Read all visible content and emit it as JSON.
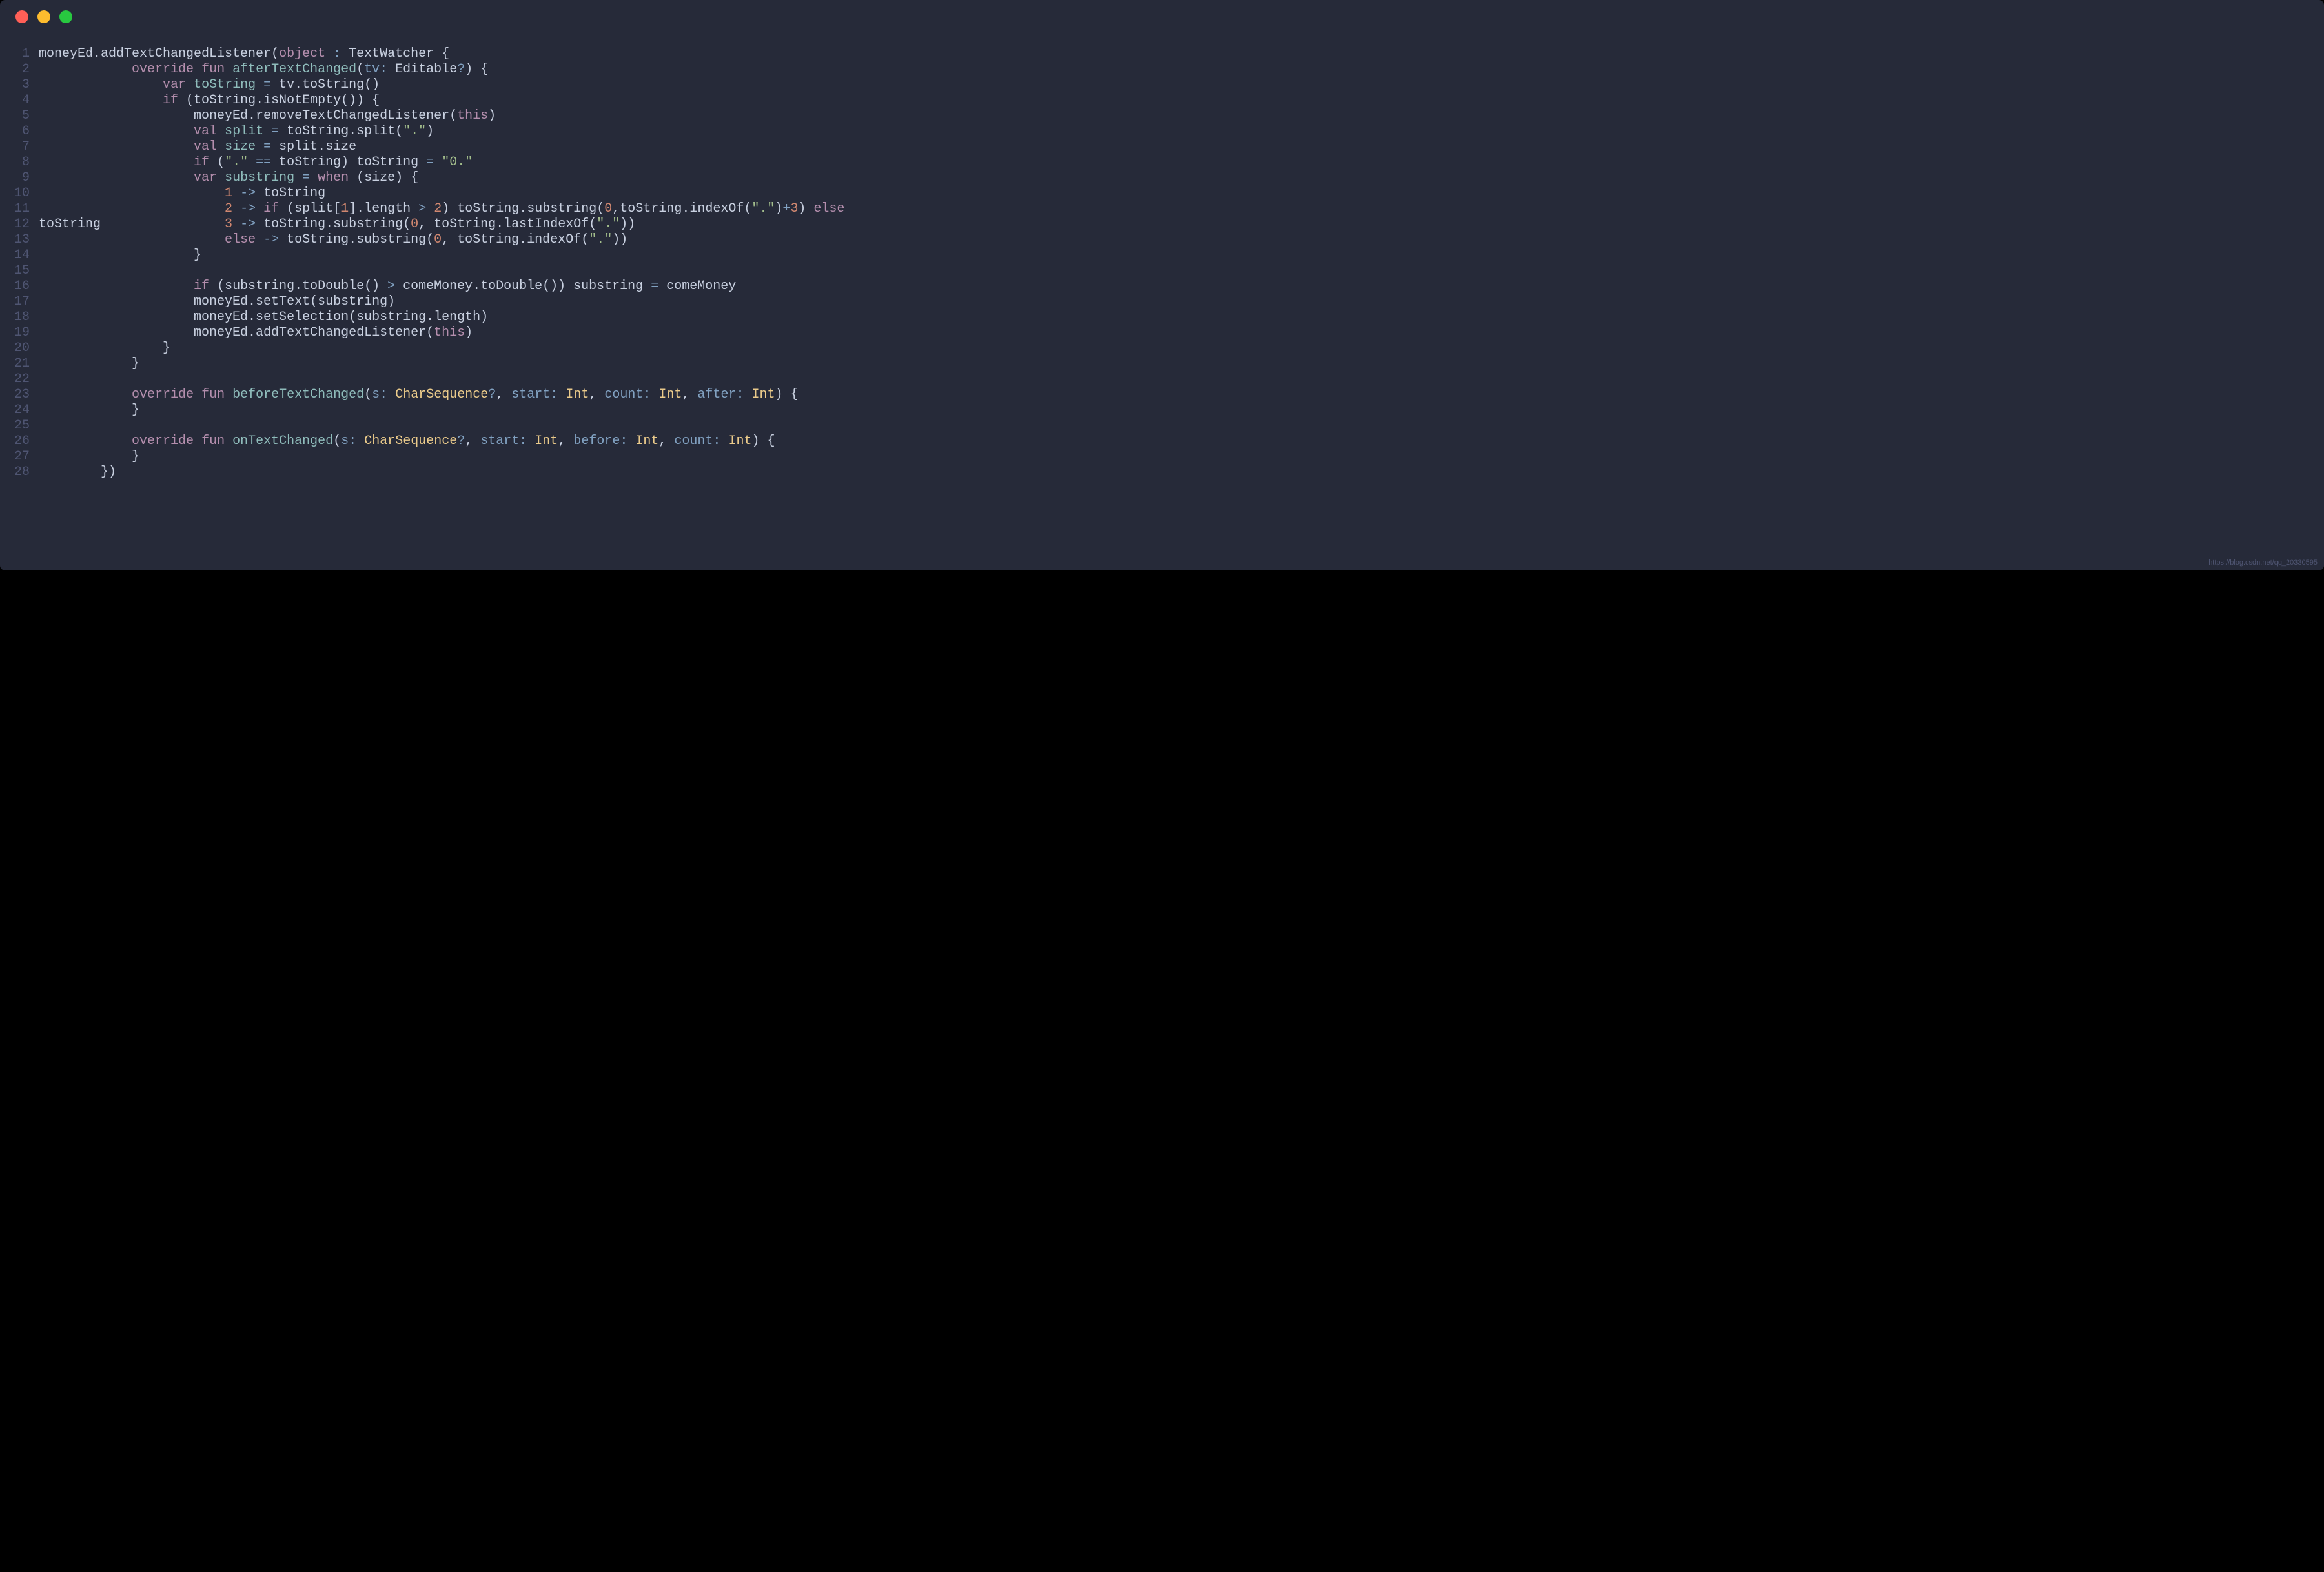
{
  "window": {
    "traffic_light_red": "close-icon",
    "traffic_light_yellow": "minimize-icon",
    "traffic_light_green": "zoom-icon"
  },
  "watermark": "https://blog.csdn.net/qq_20330595",
  "code": {
    "language": "kotlin",
    "line_count": 28,
    "lines": [
      {
        "n": 1,
        "tokens": [
          [
            "default",
            "moneyEd.addTextChangedListener("
          ],
          [
            "keyword",
            "object"
          ],
          [
            "default",
            " "
          ],
          [
            "oper",
            ":"
          ],
          [
            "default",
            " TextWatcher {"
          ]
        ]
      },
      {
        "n": 2,
        "tokens": [
          [
            "default",
            "            "
          ],
          [
            "keyword",
            "override"
          ],
          [
            "default",
            " "
          ],
          [
            "keyword",
            "fun"
          ],
          [
            "default",
            " "
          ],
          [
            "func",
            "afterTextChanged"
          ],
          [
            "default",
            "("
          ],
          [
            "prop",
            "tv"
          ],
          [
            "oper",
            ":"
          ],
          [
            "default",
            " Editable"
          ],
          [
            "oper",
            "?"
          ],
          [
            "default",
            ") {"
          ]
        ]
      },
      {
        "n": 3,
        "tokens": [
          [
            "default",
            "                "
          ],
          [
            "keyword",
            "var"
          ],
          [
            "default",
            " "
          ],
          [
            "func",
            "toString"
          ],
          [
            "default",
            " "
          ],
          [
            "oper",
            "="
          ],
          [
            "default",
            " tv.toString()"
          ]
        ]
      },
      {
        "n": 4,
        "tokens": [
          [
            "default",
            "                "
          ],
          [
            "keyword",
            "if"
          ],
          [
            "default",
            " (toString.isNotEmpty()) {"
          ]
        ]
      },
      {
        "n": 5,
        "tokens": [
          [
            "default",
            "                    moneyEd.removeTextChangedListener("
          ],
          [
            "keyword",
            "this"
          ],
          [
            "default",
            ")"
          ]
        ]
      },
      {
        "n": 6,
        "tokens": [
          [
            "default",
            "                    "
          ],
          [
            "keyword",
            "val"
          ],
          [
            "default",
            " "
          ],
          [
            "func",
            "split"
          ],
          [
            "default",
            " "
          ],
          [
            "oper",
            "="
          ],
          [
            "default",
            " toString.split("
          ],
          [
            "string",
            "\".\""
          ],
          [
            "default",
            ")"
          ]
        ]
      },
      {
        "n": 7,
        "tokens": [
          [
            "default",
            "                    "
          ],
          [
            "keyword",
            "val"
          ],
          [
            "default",
            " "
          ],
          [
            "func",
            "size"
          ],
          [
            "default",
            " "
          ],
          [
            "oper",
            "="
          ],
          [
            "default",
            " split.size"
          ]
        ]
      },
      {
        "n": 8,
        "tokens": [
          [
            "default",
            "                    "
          ],
          [
            "keyword",
            "if"
          ],
          [
            "default",
            " ("
          ],
          [
            "string",
            "\".\""
          ],
          [
            "default",
            " "
          ],
          [
            "oper",
            "=="
          ],
          [
            "default",
            " toString) toString "
          ],
          [
            "oper",
            "="
          ],
          [
            "default",
            " "
          ],
          [
            "string",
            "\"0.\""
          ]
        ]
      },
      {
        "n": 9,
        "tokens": [
          [
            "default",
            "                    "
          ],
          [
            "keyword",
            "var"
          ],
          [
            "default",
            " "
          ],
          [
            "func",
            "substring"
          ],
          [
            "default",
            " "
          ],
          [
            "oper",
            "="
          ],
          [
            "default",
            " "
          ],
          [
            "keyword",
            "when"
          ],
          [
            "default",
            " (size) {"
          ]
        ]
      },
      {
        "n": 10,
        "tokens": [
          [
            "default",
            "                        "
          ],
          [
            "number",
            "1"
          ],
          [
            "default",
            " "
          ],
          [
            "oper",
            "->"
          ],
          [
            "default",
            " toString"
          ]
        ]
      },
      {
        "n": 11,
        "tokens": [
          [
            "default",
            "                        "
          ],
          [
            "number",
            "2"
          ],
          [
            "default",
            " "
          ],
          [
            "oper",
            "->"
          ],
          [
            "default",
            " "
          ],
          [
            "keyword",
            "if"
          ],
          [
            "default",
            " (split["
          ],
          [
            "number",
            "1"
          ],
          [
            "default",
            "].length "
          ],
          [
            "oper",
            ">"
          ],
          [
            "default",
            " "
          ],
          [
            "number",
            "2"
          ],
          [
            "default",
            ") toString.substring("
          ],
          [
            "number",
            "0"
          ],
          [
            "default",
            ",toString.indexOf("
          ],
          [
            "string",
            "\".\""
          ],
          [
            "default",
            ")"
          ],
          [
            "oper",
            "+"
          ],
          [
            "number",
            "3"
          ],
          [
            "default",
            ") "
          ],
          [
            "keyword",
            "else"
          ]
        ]
      },
      {
        "n": 12,
        "tokens": [
          [
            "default",
            "toString                "
          ],
          [
            "number",
            "3"
          ],
          [
            "default",
            " "
          ],
          [
            "oper",
            "->"
          ],
          [
            "default",
            " toString.substring("
          ],
          [
            "number",
            "0"
          ],
          [
            "default",
            ", toString.lastIndexOf("
          ],
          [
            "string",
            "\".\""
          ],
          [
            "default",
            "))"
          ]
        ]
      },
      {
        "n": 13,
        "tokens": [
          [
            "default",
            "                        "
          ],
          [
            "keyword",
            "else"
          ],
          [
            "default",
            " "
          ],
          [
            "oper",
            "->"
          ],
          [
            "default",
            " toString.substring("
          ],
          [
            "number",
            "0"
          ],
          [
            "default",
            ", toString.indexOf("
          ],
          [
            "string",
            "\".\""
          ],
          [
            "default",
            "))"
          ]
        ]
      },
      {
        "n": 14,
        "tokens": [
          [
            "default",
            "                    }"
          ]
        ]
      },
      {
        "n": 15,
        "tokens": [
          [
            "default",
            ""
          ]
        ]
      },
      {
        "n": 16,
        "tokens": [
          [
            "default",
            "                    "
          ],
          [
            "keyword",
            "if"
          ],
          [
            "default",
            " (substring.toDouble() "
          ],
          [
            "oper",
            ">"
          ],
          [
            "default",
            " comeMoney.toDouble()) substring "
          ],
          [
            "oper",
            "="
          ],
          [
            "default",
            " comeMoney"
          ]
        ]
      },
      {
        "n": 17,
        "tokens": [
          [
            "default",
            "                    moneyEd.setText(substring)"
          ]
        ]
      },
      {
        "n": 18,
        "tokens": [
          [
            "default",
            "                    moneyEd.setSelection(substring.length)"
          ]
        ]
      },
      {
        "n": 19,
        "tokens": [
          [
            "default",
            "                    moneyEd.addTextChangedListener("
          ],
          [
            "keyword",
            "this"
          ],
          [
            "default",
            ")"
          ]
        ]
      },
      {
        "n": 20,
        "tokens": [
          [
            "default",
            "                }"
          ]
        ]
      },
      {
        "n": 21,
        "tokens": [
          [
            "default",
            "            }"
          ]
        ]
      },
      {
        "n": 22,
        "tokens": [
          [
            "default",
            ""
          ]
        ]
      },
      {
        "n": 23,
        "tokens": [
          [
            "default",
            "            "
          ],
          [
            "keyword",
            "override"
          ],
          [
            "default",
            " "
          ],
          [
            "keyword",
            "fun"
          ],
          [
            "default",
            " "
          ],
          [
            "func",
            "beforeTextChanged"
          ],
          [
            "default",
            "("
          ],
          [
            "prop",
            "s"
          ],
          [
            "oper",
            ":"
          ],
          [
            "default",
            " "
          ],
          [
            "type",
            "CharSequence"
          ],
          [
            "oper",
            "?"
          ],
          [
            "default",
            ", "
          ],
          [
            "prop",
            "start"
          ],
          [
            "oper",
            ":"
          ],
          [
            "default",
            " "
          ],
          [
            "type",
            "Int"
          ],
          [
            "default",
            ", "
          ],
          [
            "prop",
            "count"
          ],
          [
            "oper",
            ":"
          ],
          [
            "default",
            " "
          ],
          [
            "type",
            "Int"
          ],
          [
            "default",
            ", "
          ],
          [
            "prop",
            "after"
          ],
          [
            "oper",
            ":"
          ],
          [
            "default",
            " "
          ],
          [
            "type",
            "Int"
          ],
          [
            "default",
            ") {"
          ]
        ]
      },
      {
        "n": 24,
        "tokens": [
          [
            "default",
            "            }"
          ]
        ]
      },
      {
        "n": 25,
        "tokens": [
          [
            "default",
            ""
          ]
        ]
      },
      {
        "n": 26,
        "tokens": [
          [
            "default",
            "            "
          ],
          [
            "keyword",
            "override"
          ],
          [
            "default",
            " "
          ],
          [
            "keyword",
            "fun"
          ],
          [
            "default",
            " "
          ],
          [
            "func",
            "onTextChanged"
          ],
          [
            "default",
            "("
          ],
          [
            "prop",
            "s"
          ],
          [
            "oper",
            ":"
          ],
          [
            "default",
            " "
          ],
          [
            "type",
            "CharSequence"
          ],
          [
            "oper",
            "?"
          ],
          [
            "default",
            ", "
          ],
          [
            "prop",
            "start"
          ],
          [
            "oper",
            ":"
          ],
          [
            "default",
            " "
          ],
          [
            "type",
            "Int"
          ],
          [
            "default",
            ", "
          ],
          [
            "prop",
            "before"
          ],
          [
            "oper",
            ":"
          ],
          [
            "default",
            " "
          ],
          [
            "type",
            "Int"
          ],
          [
            "default",
            ", "
          ],
          [
            "prop",
            "count"
          ],
          [
            "oper",
            ":"
          ],
          [
            "default",
            " "
          ],
          [
            "type",
            "Int"
          ],
          [
            "default",
            ") {"
          ]
        ]
      },
      {
        "n": 27,
        "tokens": [
          [
            "default",
            "            }"
          ]
        ]
      },
      {
        "n": 28,
        "tokens": [
          [
            "default",
            "        })"
          ]
        ]
      }
    ]
  }
}
